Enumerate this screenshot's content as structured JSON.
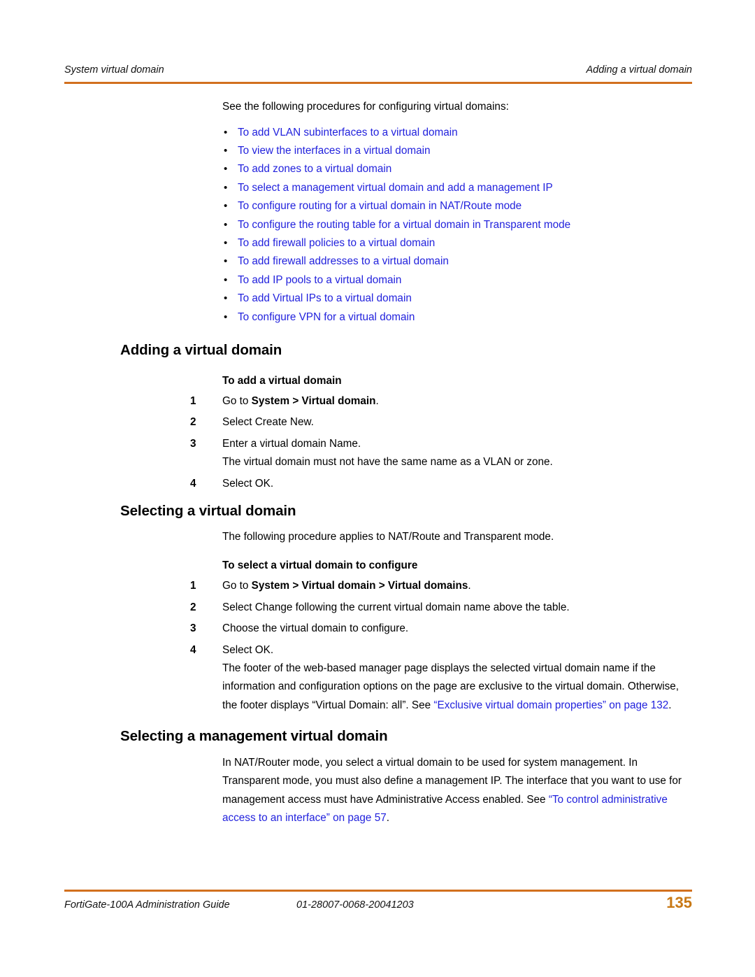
{
  "header": {
    "left": "System virtual domain",
    "right": "Adding a virtual domain"
  },
  "intro": {
    "text": "See the following procedures for configuring virtual domains:"
  },
  "procedure_links": [
    "To add VLAN subinterfaces to a virtual domain",
    "To view the interfaces in a virtual domain",
    "To add zones to a virtual domain",
    "To select a management virtual domain and add a management IP",
    "To configure routing for a virtual domain in NAT/Route mode",
    "To configure the routing table for a virtual domain in Transparent mode",
    "To add firewall policies to a virtual domain",
    "To add firewall addresses to a virtual domain",
    "To add IP pools to a virtual domain",
    "To add Virtual IPs to a virtual domain",
    "To configure VPN for a virtual domain"
  ],
  "bullet_glyph": "•",
  "section_adding": {
    "heading": "Adding a virtual domain",
    "subhead": "To add a virtual domain",
    "steps": [
      {
        "num": "1",
        "pre": "Go to ",
        "bold": "System > Virtual domain",
        "post": "."
      },
      {
        "num": "2",
        "pre": "Select Create New.",
        "bold": "",
        "post": ""
      },
      {
        "num": "3",
        "pre": "Enter a virtual domain Name.",
        "bold": "",
        "post": "",
        "cont": "The virtual domain must not have the same name as a VLAN or zone."
      },
      {
        "num": "4",
        "pre": "Select OK.",
        "bold": "",
        "post": ""
      }
    ]
  },
  "section_selecting": {
    "heading": "Selecting a virtual domain",
    "intro": "The following procedure applies to NAT/Route and Transparent mode.",
    "subhead": "To select a virtual domain to configure",
    "steps": [
      {
        "num": "1",
        "pre": "Go to ",
        "bold": "System > Virtual domain > Virtual domains",
        "post": "."
      },
      {
        "num": "2",
        "pre": "Select Change following the current virtual domain name above the table.",
        "bold": "",
        "post": ""
      },
      {
        "num": "3",
        "pre": "Choose the virtual domain to configure.",
        "bold": "",
        "post": ""
      },
      {
        "num": "4",
        "pre": "Select OK.",
        "bold": "",
        "post": "",
        "cont_para": {
          "lead": "The footer of the web-based manager page displays the selected virtual domain name if the information and configuration options on the page are exclusive to the virtual domain. Otherwise, the footer displays “Virtual Domain: all”. See ",
          "xref": "“Exclusive virtual domain properties” on page 132",
          "tail": "."
        }
      }
    ]
  },
  "section_management": {
    "heading": "Selecting a management virtual domain",
    "paragraph": {
      "lead": "In NAT/Router mode, you select a virtual domain to be used for system management. In Transparent mode, you must also define a management IP. The interface that you want to use for management access must have Administrative Access enabled. See ",
      "xref": "“To control administrative access to an interface” on page 57",
      "tail": "."
    }
  },
  "footer": {
    "guide": "FortiGate-100A Administration Guide",
    "doc_number": "01-28007-0068-20041203",
    "page_number": "135"
  },
  "colors": {
    "rule": "#D2701E",
    "link": "#2222DD",
    "page_number": "#C87814"
  }
}
